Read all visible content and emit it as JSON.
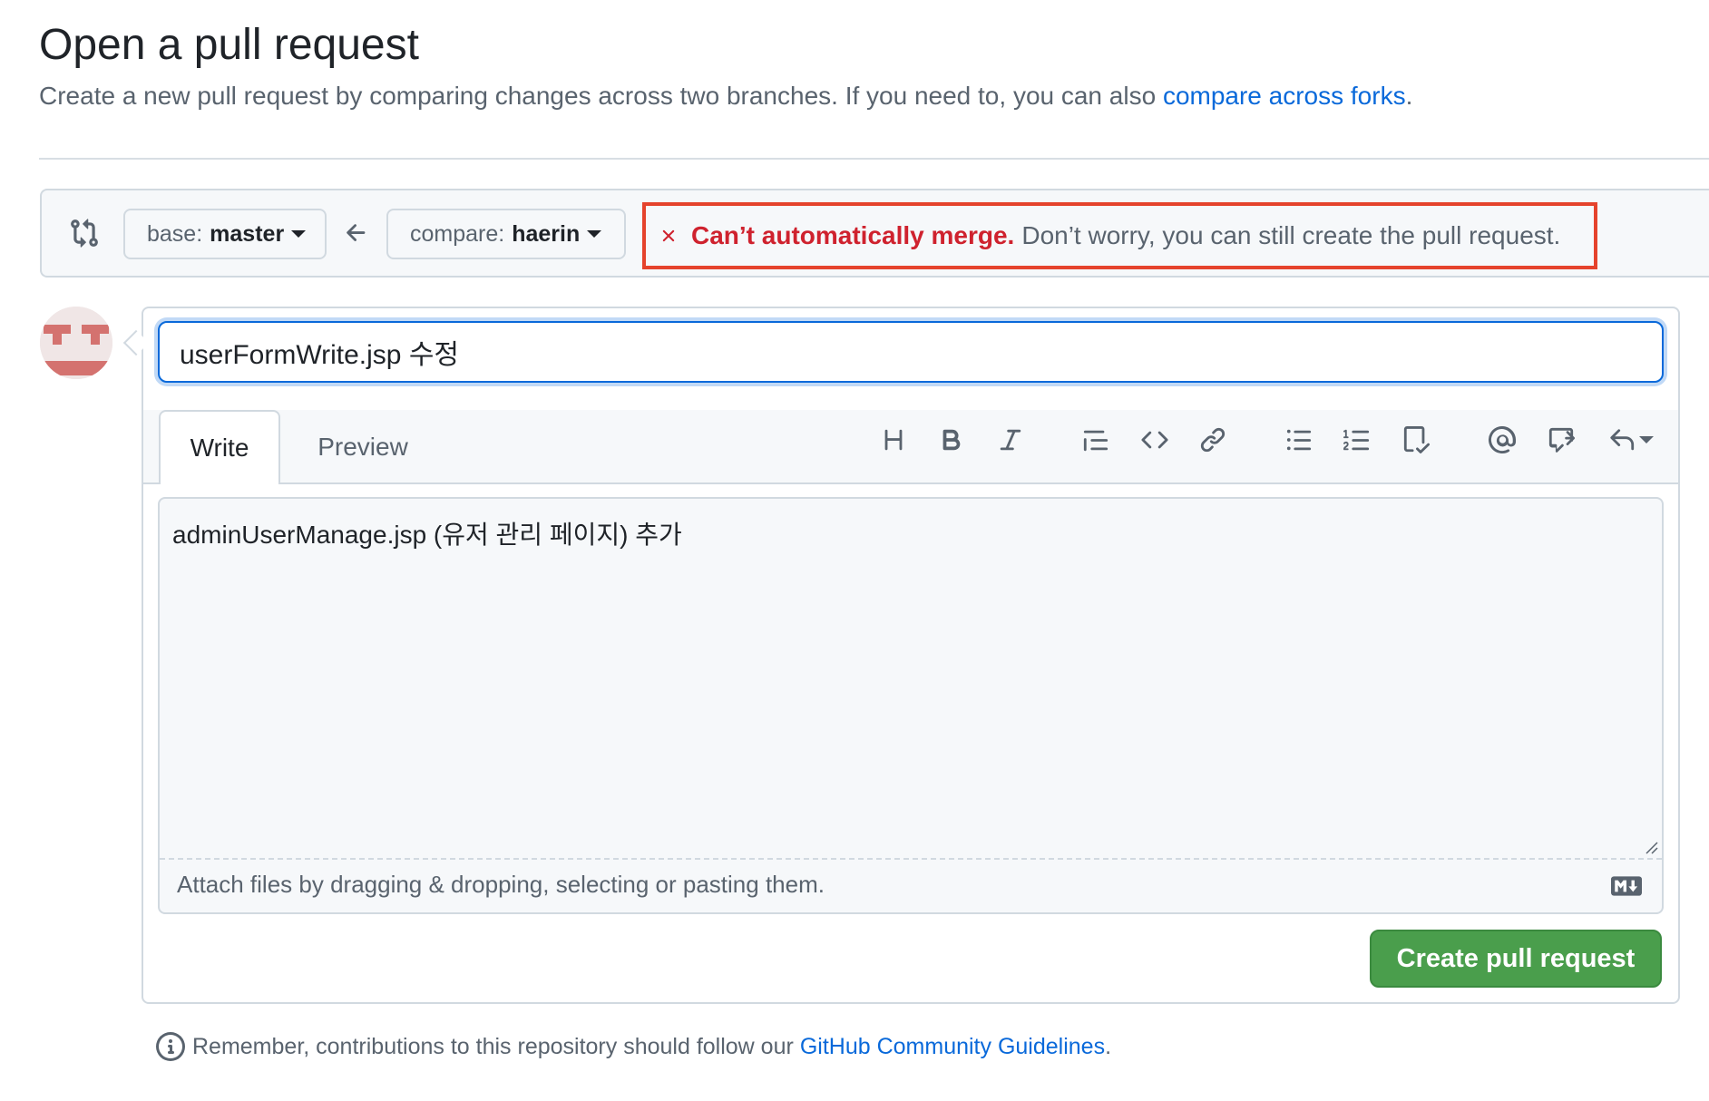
{
  "header": {
    "title": "Open a pull request",
    "description_prefix": "Create a new pull request by comparing changes across two branches. If you need to, you can also ",
    "description_link": "compare across forks",
    "description_suffix": "."
  },
  "compare": {
    "base_label": "base:",
    "base_value": "master",
    "compare_label": "compare:",
    "compare_value": "haerin",
    "merge_status_strong": "Can’t automatically merge.",
    "merge_status_rest": "Don’t worry, you can still create the pull request."
  },
  "form": {
    "title_value": "userFormWrite.jsp 수정",
    "tabs": [
      "Write",
      "Preview"
    ],
    "body_text": "adminUserManage.jsp (유저 관리 페이지) 추가",
    "attach_text": "Attach files by dragging & dropping, selecting or pasting them.",
    "submit_label": "Create pull request"
  },
  "toolbar": [
    "heading-icon",
    "bold-icon",
    "italic-icon",
    "quote-icon",
    "code-icon",
    "link-icon",
    "unordered-list-icon",
    "ordered-list-icon",
    "task-list-icon",
    "mention-icon",
    "cross-reference-icon",
    "saved-replies-icon"
  ],
  "footer": {
    "prefix": "Remember, contributions to this repository should follow our ",
    "link": "GitHub Community Guidelines",
    "suffix": "."
  },
  "colors": {
    "link": "#0969da",
    "danger": "#cf222e",
    "highlight_border": "#e5432c",
    "primary_button": "#4a9e4c"
  }
}
